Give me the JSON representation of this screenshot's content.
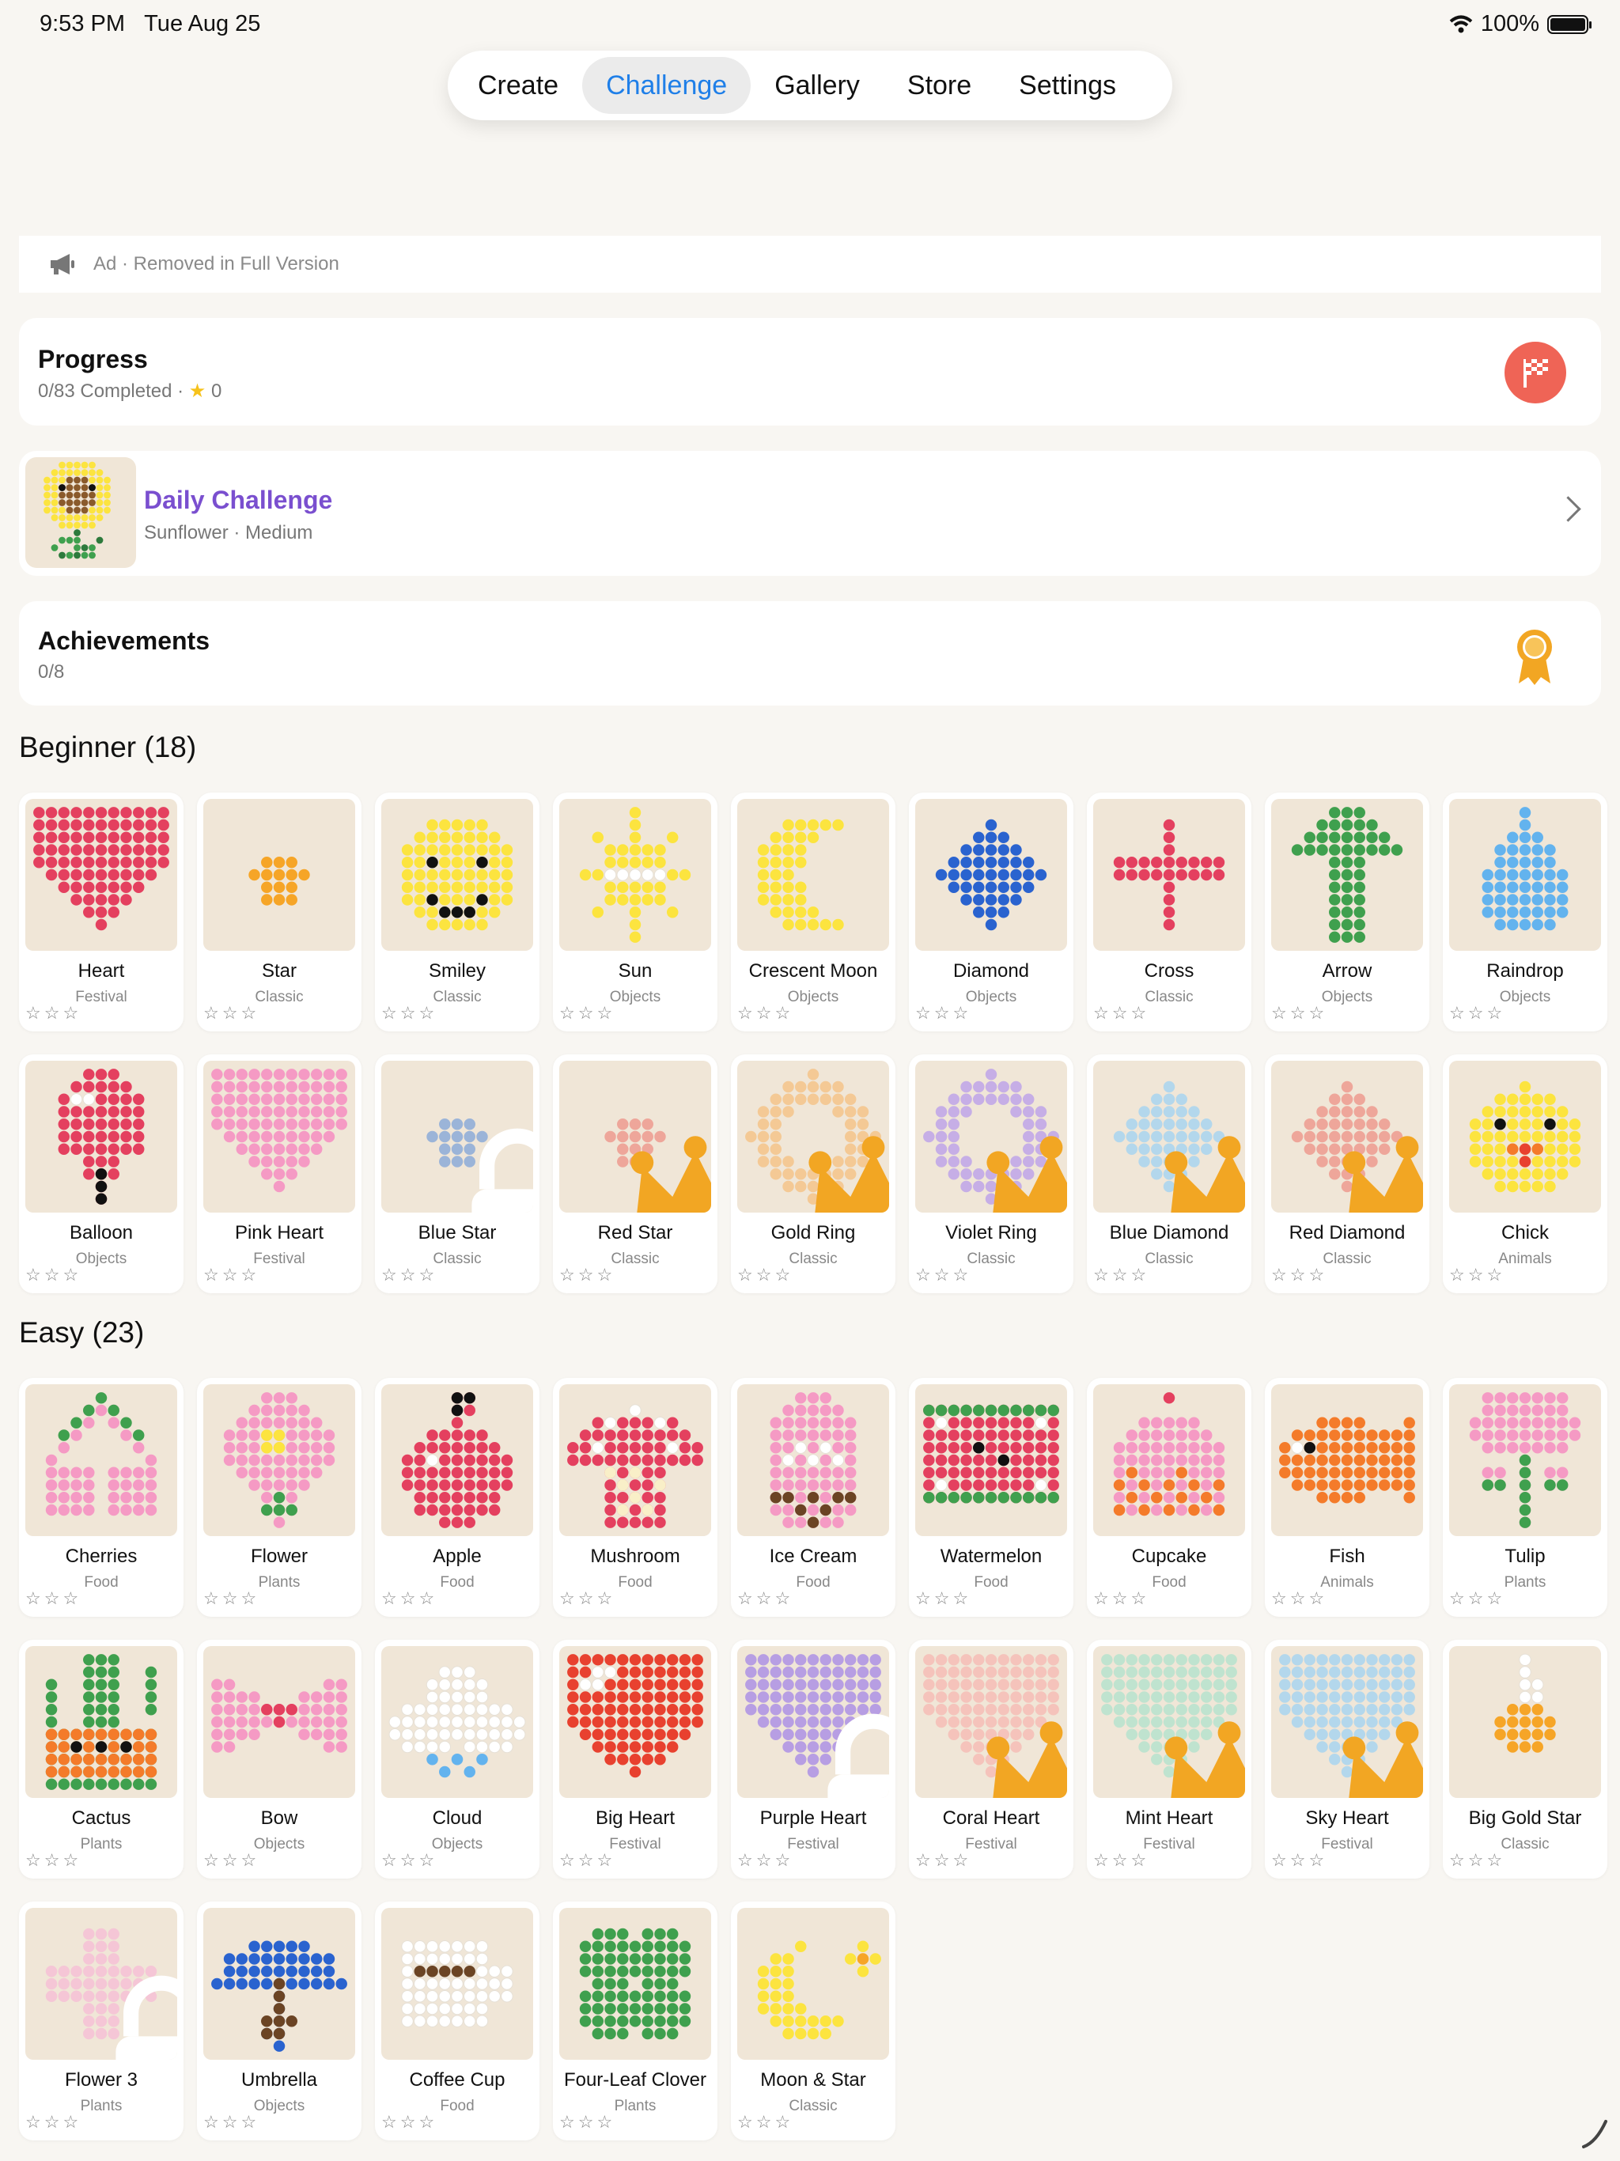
{
  "status": {
    "time": "9:53 PM",
    "date": "Tue Aug 25",
    "battery": "100%"
  },
  "tabs": [
    {
      "label": "Create",
      "active": false
    },
    {
      "label": "Challenge",
      "active": true
    },
    {
      "label": "Gallery",
      "active": false
    },
    {
      "label": "Store",
      "active": false
    },
    {
      "label": "Settings",
      "active": false
    }
  ],
  "ad": {
    "text": "Ad · Removed in Full Version",
    "icon": "megaphone-icon"
  },
  "progress": {
    "title": "Progress",
    "completed": "0/83 Completed ·",
    "stars": "0",
    "icon": "checkered-flag-icon",
    "accent": "#ef6456"
  },
  "daily": {
    "title": "Daily Challenge",
    "subtitle": "Sunflower · Medium",
    "color": "#7a4fcf"
  },
  "achievements": {
    "title": "Achievements",
    "count": "0/8",
    "icon": "ribbon-icon",
    "accent": "#f2a623"
  },
  "sections": [
    {
      "title": "Beginner (18)",
      "items": [
        {
          "name": "Heart",
          "category": "Festival",
          "art": "heart",
          "color": "#e4405f",
          "state": "open"
        },
        {
          "name": "Star",
          "category": "Classic",
          "art": "star",
          "color": "#f6a527",
          "state": "open"
        },
        {
          "name": "Smiley",
          "category": "Classic",
          "art": "smiley",
          "color": "#fce43f",
          "state": "open"
        },
        {
          "name": "Sun",
          "category": "Objects",
          "art": "sun",
          "color": "#fce43f",
          "state": "open"
        },
        {
          "name": "Crescent Moon",
          "category": "Objects",
          "art": "moon",
          "color": "#fce43f",
          "state": "open"
        },
        {
          "name": "Diamond",
          "category": "Objects",
          "art": "diamond",
          "color": "#2a63cf",
          "state": "open"
        },
        {
          "name": "Cross",
          "category": "Classic",
          "art": "cross",
          "color": "#e4405f",
          "state": "open"
        },
        {
          "name": "Arrow",
          "category": "Objects",
          "art": "arrow",
          "color": "#3fa04e",
          "state": "open"
        },
        {
          "name": "Raindrop",
          "category": "Objects",
          "art": "drop",
          "color": "#63b3ee",
          "state": "open"
        },
        {
          "name": "Balloon",
          "category": "Objects",
          "art": "balloon",
          "color": "#e4405f",
          "state": "open"
        },
        {
          "name": "Pink Heart",
          "category": "Festival",
          "art": "heart",
          "color": "#f59ac4",
          "state": "open"
        },
        {
          "name": "Blue Star",
          "category": "Classic",
          "art": "star",
          "color": "#9bb4d8",
          "state": "locked"
        },
        {
          "name": "Red Star",
          "category": "Classic",
          "art": "star",
          "color": "#eea69a",
          "state": "premium"
        },
        {
          "name": "Gold Ring",
          "category": "Classic",
          "art": "ring",
          "color": "#f4c995",
          "state": "premium"
        },
        {
          "name": "Violet Ring",
          "category": "Classic",
          "art": "ring",
          "color": "#c6aee6",
          "state": "premium"
        },
        {
          "name": "Blue Diamond",
          "category": "Classic",
          "art": "diamond",
          "color": "#b3d7ec",
          "state": "premium"
        },
        {
          "name": "Red Diamond",
          "category": "Classic",
          "art": "diamond",
          "color": "#eea69a",
          "state": "premium"
        },
        {
          "name": "Chick",
          "category": "Animals",
          "art": "chick",
          "color": "#fce43f",
          "state": "open"
        }
      ]
    },
    {
      "title": "Easy (23)",
      "items": [
        {
          "name": "Cherries",
          "category": "Food",
          "art": "cherries",
          "color": "#f59ac4",
          "state": "open"
        },
        {
          "name": "Flower",
          "category": "Plants",
          "art": "flower",
          "color": "#f59ac4",
          "state": "open"
        },
        {
          "name": "Apple",
          "category": "Food",
          "art": "apple",
          "color": "#e4405f",
          "state": "open"
        },
        {
          "name": "Mushroom",
          "category": "Food",
          "art": "mushroom",
          "color": "#e4405f",
          "state": "open"
        },
        {
          "name": "Ice Cream",
          "category": "Food",
          "art": "icecream",
          "color": "#f59ac4",
          "state": "open"
        },
        {
          "name": "Watermelon",
          "category": "Food",
          "art": "watermelon",
          "color": "#e4405f",
          "state": "open"
        },
        {
          "name": "Cupcake",
          "category": "Food",
          "art": "cupcake",
          "color": "#f59ac4",
          "state": "open"
        },
        {
          "name": "Fish",
          "category": "Animals",
          "art": "fish",
          "color": "#f47b2a",
          "state": "open"
        },
        {
          "name": "Tulip",
          "category": "Plants",
          "art": "tulip",
          "color": "#f59ac4",
          "state": "open"
        },
        {
          "name": "Cactus",
          "category": "Plants",
          "art": "cactus",
          "color": "#3fa04e",
          "state": "open"
        },
        {
          "name": "Bow",
          "category": "Objects",
          "art": "bow",
          "color": "#f59ac4",
          "state": "open"
        },
        {
          "name": "Cloud",
          "category": "Objects",
          "art": "cloud",
          "color": "#ffffff",
          "state": "open"
        },
        {
          "name": "Big Heart",
          "category": "Festival",
          "art": "bigheart",
          "color": "#e8412f",
          "state": "open"
        },
        {
          "name": "Purple Heart",
          "category": "Festival",
          "art": "heart",
          "color": "#b79ee3",
          "state": "locked"
        },
        {
          "name": "Coral Heart",
          "category": "Festival",
          "art": "heart",
          "color": "#f5c3bb",
          "state": "premium"
        },
        {
          "name": "Mint Heart",
          "category": "Festival",
          "art": "heart",
          "color": "#bfe3cf",
          "state": "premium"
        },
        {
          "name": "Sky Heart",
          "category": "Festival",
          "art": "heart",
          "color": "#b3d7ec",
          "state": "premium"
        },
        {
          "name": "Big Gold Star",
          "category": "Classic",
          "art": "bigstar",
          "color": "#f6a527",
          "state": "open"
        },
        {
          "name": "Flower 3",
          "category": "Plants",
          "art": "flower4",
          "color": "#f5c6d6",
          "state": "locked"
        },
        {
          "name": "Umbrella",
          "category": "Objects",
          "art": "umbrella",
          "color": "#2a63cf",
          "state": "open"
        },
        {
          "name": "Coffee Cup",
          "category": "Food",
          "art": "cup",
          "color": "#ffffff",
          "state": "open"
        },
        {
          "name": "Four-Leaf Clover",
          "category": "Plants",
          "art": "clover",
          "color": "#3fa04e",
          "state": "open"
        },
        {
          "name": "Moon & Star",
          "category": "Classic",
          "art": "moonstar",
          "color": "#fce43f",
          "state": "open"
        }
      ]
    }
  ],
  "star_glyphs": "☆☆☆"
}
